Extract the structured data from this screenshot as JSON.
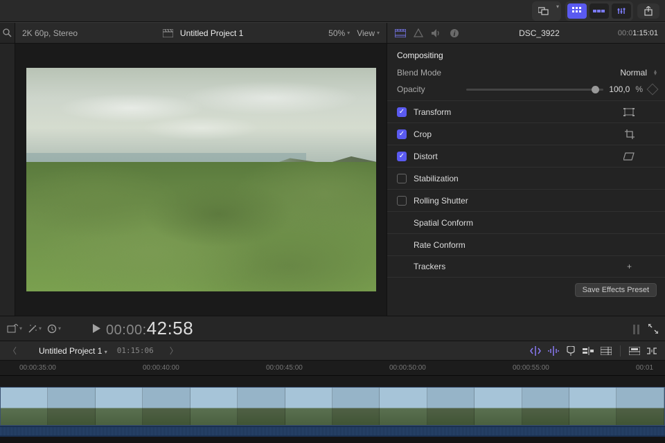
{
  "viewer": {
    "format": "2K 60p, Stereo",
    "title": "Untitled Project 1",
    "zoom": "50%",
    "view_label": "View"
  },
  "inspector": {
    "clip_name": "DSC_3922",
    "timecode_dim": "00:0",
    "timecode_lit": "1:15:01",
    "compositing": "Compositing",
    "blend_mode_label": "Blend Mode",
    "blend_mode_value": "Normal",
    "opacity_label": "Opacity",
    "opacity_value": "100,0",
    "opacity_unit": "%",
    "rows": {
      "transform": "Transform",
      "crop": "Crop",
      "distort": "Distort",
      "stabilization": "Stabilization",
      "rolling_shutter": "Rolling Shutter",
      "spatial_conform": "Spatial Conform",
      "rate_conform": "Rate Conform",
      "trackers": "Trackers"
    },
    "save_preset": "Save Effects Preset"
  },
  "transport": {
    "tc_dim": "00:00:",
    "tc_lit": "42:58"
  },
  "projbar": {
    "name": "Untitled Project 1",
    "duration": "01:15:06"
  },
  "ruler": {
    "ticks": [
      "00:00:35:00",
      "00:00:40:00",
      "00:00:45:00",
      "00:00:50:00",
      "00:00:55:00",
      "00:01"
    ]
  }
}
